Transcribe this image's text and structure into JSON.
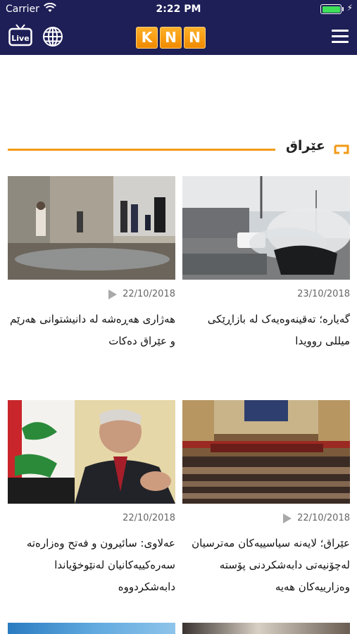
{
  "status_bar": {
    "carrier": "Carrier",
    "time": "2:22 PM"
  },
  "nav": {
    "live_label": "Live",
    "logo_letters": [
      "K",
      "N",
      "N"
    ],
    "icons": [
      "tv-live-icon",
      "globe-icon",
      "hamburger-menu-icon"
    ],
    "bar_color": "#1e1f57",
    "logo_color": "#f59a10"
  },
  "section": {
    "title": "عێراق",
    "accent_color": "#f29a16"
  },
  "articles": [
    {
      "date": "23/10/2018",
      "has_video": false,
      "title": "گەیارە؛ تەقینەوەیەک لە بازاڕێکی میللی روویدا"
    },
    {
      "date": "22/10/2018",
      "has_video": true,
      "title": "هەژاری هەڕەشە لە دانیشتوانی هەرێم و عێراق دەکات"
    },
    {
      "date": "22/10/2018",
      "has_video": true,
      "title": "عێراق؛ لایەنە سیاسییەکان مەترسیان لەچۆنیەتی دابەشکردنی پۆستە وەزارییەکان هەیە"
    },
    {
      "date": "22/10/2018",
      "has_video": false,
      "title": "عەلاوی: سائیرون و فەتح وەزارەتە سەرەکییەکانیان لەنێوخۆیاندا دابەشکردووە"
    }
  ]
}
